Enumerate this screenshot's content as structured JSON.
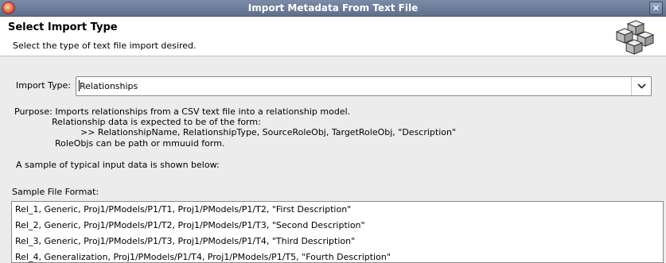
{
  "window": {
    "title": "Import Metadata From Text File"
  },
  "header": {
    "title": "Select Import Type",
    "description": "Select the type of text file import desired."
  },
  "import_type": {
    "label": "Import Type:",
    "value": "Relationships"
  },
  "purpose": {
    "line1": "Purpose: Imports relationships from a CSV text file into a relationship model.",
    "line2": "Relationship data is expected to be of the form:",
    "line3": ">> RelationshipName, RelationshipType, SourceRoleObj, TargetRoleObj, \"Description\"",
    "line4": "RoleObjs can be path or mmuuid form."
  },
  "sample_note": "A sample of typical input data is shown below:",
  "sample_file": {
    "label": "Sample File Format:",
    "lines": [
      "Rel_1, Generic, Proj1/PModels/P1/T1, Proj1/PModels/P1/T2, \"First Description\"",
      "Rel_2, Generic, Proj1/PModels/P1/T2, Proj1/PModels/P1/T3, \"Second Description\"",
      "Rel_3, Generic, Proj1/PModels/P1/T3, Proj1/PModels/P1/T4, \"Third Description\"",
      "Rel_4, Generalization, Proj1/PModels/P1/T4, Proj1/PModels/P1/T5, \"Fourth Description\""
    ]
  }
}
